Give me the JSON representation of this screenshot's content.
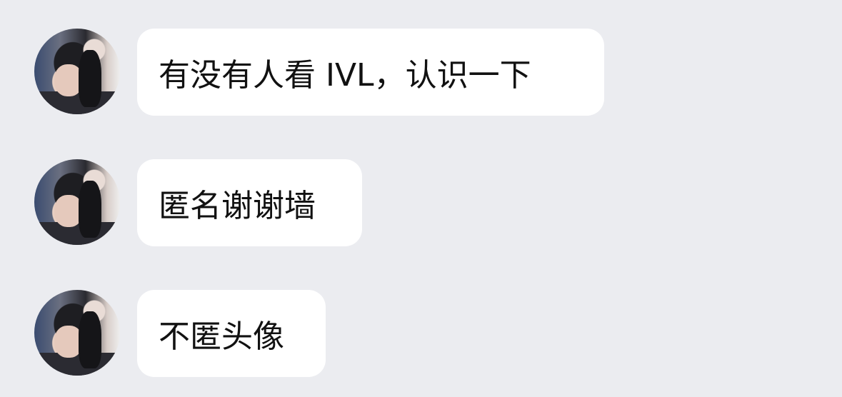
{
  "messages": [
    {
      "avatar_icon": "user-avatar-photo",
      "text": "有没有人看 IVL，认识一下"
    },
    {
      "avatar_icon": "user-avatar-photo",
      "text": "匿名谢谢墙"
    },
    {
      "avatar_icon": "user-avatar-photo",
      "text": "不匿头像"
    }
  ]
}
